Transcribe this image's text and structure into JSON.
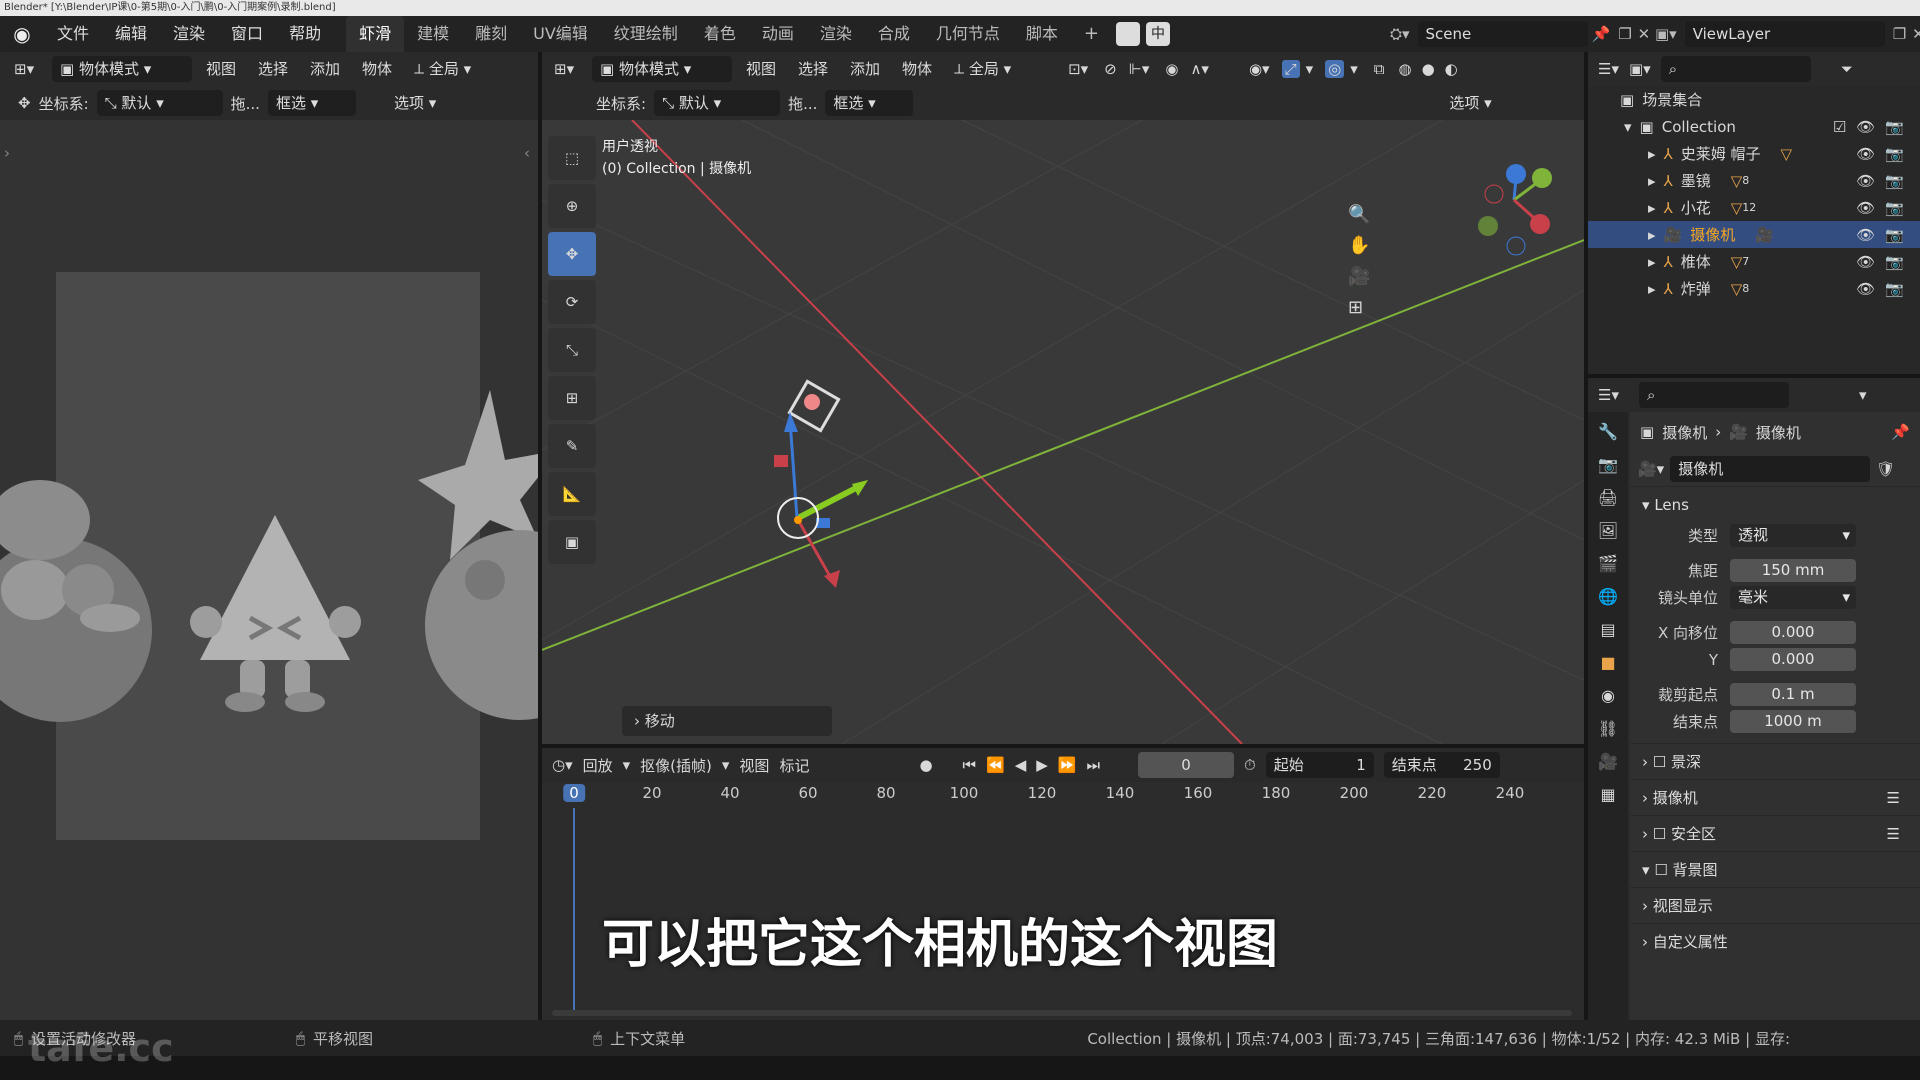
{
  "window": {
    "title": "Blender* [Y:\\Blender\\IP课\\0-第5期\\0-入门\\鹏\\0-入门期案例\\录制.blend]"
  },
  "menu": [
    "文件",
    "编辑",
    "渲染",
    "窗口",
    "帮助"
  ],
  "workspaces": [
    "虾滑",
    "建模",
    "雕刻",
    "UV编辑",
    "纹理绘制",
    "着色",
    "动画",
    "渲染",
    "合成",
    "几何节点",
    "脚本"
  ],
  "active_workspace_index": 0,
  "scene": {
    "label": "Scene",
    "view_layer": "ViewLayer"
  },
  "left_view": {
    "mode": "物体模式",
    "menus": [
      "视图",
      "选择",
      "添加",
      "物体"
    ],
    "orientation": "全局",
    "coord_label": "坐标系:",
    "coord_value": "默认",
    "drag_label": "拖...",
    "select": "框选",
    "options": "选项"
  },
  "viewport": {
    "mode": "物体模式",
    "menus": [
      "视图",
      "选择",
      "添加",
      "物体"
    ],
    "orientation": "全局",
    "coord_label": "坐标系:",
    "coord_value": "默认",
    "drag_label": "拖...",
    "select": "框选",
    "options": "选项",
    "view_name": "用户透视",
    "view_sub": "(0) Collection | 摄像机",
    "last_op": "移动"
  },
  "outliner": {
    "root": "场景集合",
    "collection": "Collection",
    "items": [
      {
        "name": "史莱姆 帽子",
        "badge": ""
      },
      {
        "name": "墨镜",
        "badge": "8"
      },
      {
        "name": "小花",
        "badge": "12"
      },
      {
        "name": "摄像机",
        "badge": "",
        "selected": true
      },
      {
        "name": "椎体",
        "badge": "7"
      },
      {
        "name": "炸弹",
        "badge": "8"
      }
    ]
  },
  "props": {
    "breadcrumb_obj": "摄像机",
    "breadcrumb_data": "摄像机",
    "data_name": "摄像机",
    "lens_title": "Lens",
    "type_label": "类型",
    "type_value": "透视",
    "focal_label": "焦距",
    "focal_value": "150 mm",
    "unit_label": "镜头单位",
    "unit_value": "毫米",
    "shiftx_label": "X 向移位",
    "shiftx_value": "0.000",
    "shifty_label": "Y",
    "shifty_value": "0.000",
    "clipstart_label": "裁剪起点",
    "clipstart_value": "0.1 m",
    "clipend_label": "结束点",
    "clipend_value": "1000 m",
    "sections": [
      "景深",
      "摄像机",
      "安全区",
      "背景图",
      "视图显示",
      "自定义属性"
    ]
  },
  "timeline": {
    "menus": [
      "回放",
      "抠像(插帧)",
      "视图",
      "标记"
    ],
    "current_frame": "0",
    "start_label": "起始",
    "start": "1",
    "end_label": "结束点",
    "end": "250",
    "ticks": [
      "0",
      "20",
      "40",
      "60",
      "80",
      "100",
      "120",
      "140",
      "160",
      "180",
      "200",
      "220",
      "240"
    ]
  },
  "subtitle": "可以把它这个相机的这个视图",
  "status": {
    "left": "设置活动修改器",
    "mid": "平移视图",
    "ctx": "上下文菜单",
    "right": "Collection | 摄像机 | 顶点:74,003 | 面:73,745 | 三角面:147,636 | 物体:1/52 | 内存: 42.3 MiB | 显存:"
  },
  "watermark": "tafe.cc",
  "colors": {
    "accent": "#4772b3",
    "selected_row": "#334d80",
    "x_axis": "#c8404a",
    "y_axis": "#7fb33a",
    "z_axis": "#3c79d6"
  }
}
